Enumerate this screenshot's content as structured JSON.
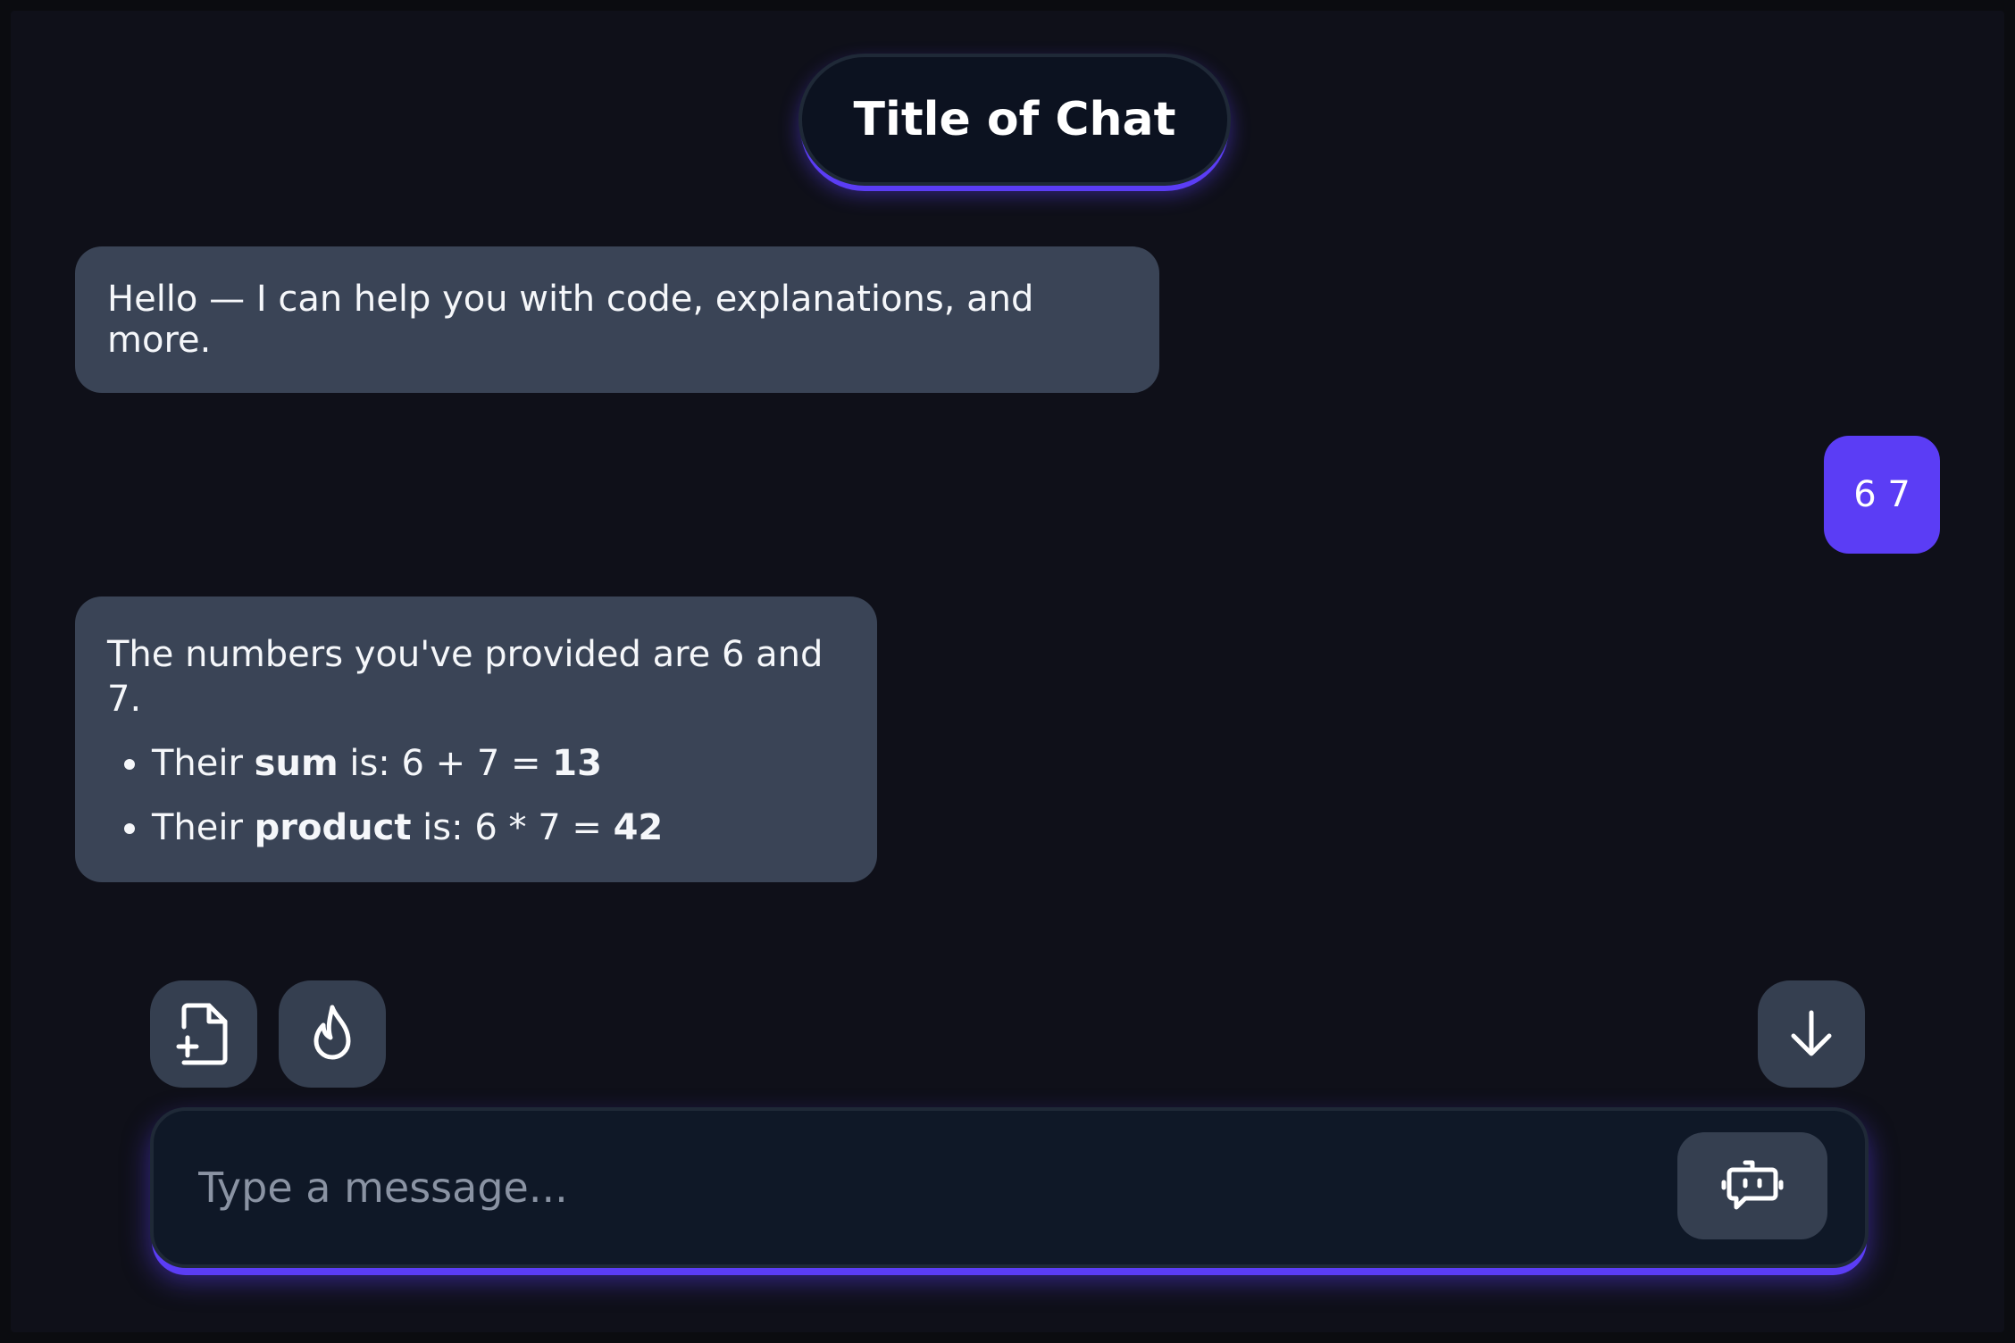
{
  "header": {
    "title": "Title of Chat"
  },
  "messages": {
    "greeting": {
      "role": "assistant",
      "text": "Hello — I can help you with code, explanations, and more."
    },
    "user": {
      "role": "user",
      "text": "6 7"
    },
    "reply": {
      "role": "assistant",
      "intro": "The numbers you've provided are 6 and 7.",
      "items": [
        {
          "prefix": "Their ",
          "term": "sum",
          "middle": " is: 6 + 7 = ",
          "result": "13"
        },
        {
          "prefix": "Their ",
          "term": "product",
          "middle": " is: 6 * 7 = ",
          "result": "42"
        }
      ]
    }
  },
  "toolbar": {
    "attach_icon": "file-plus-icon",
    "flame_icon": "flame-icon",
    "scroll_icon": "arrow-down-icon"
  },
  "composer": {
    "placeholder": "Type a message...",
    "value": "",
    "send_icon": "bot-icon"
  },
  "colors": {
    "background": "#0f1019",
    "assistant_bubble": "#3a4456",
    "user_bubble": "#5b3df5",
    "accent_glow": "#5b3df5",
    "button": "#353f50"
  }
}
